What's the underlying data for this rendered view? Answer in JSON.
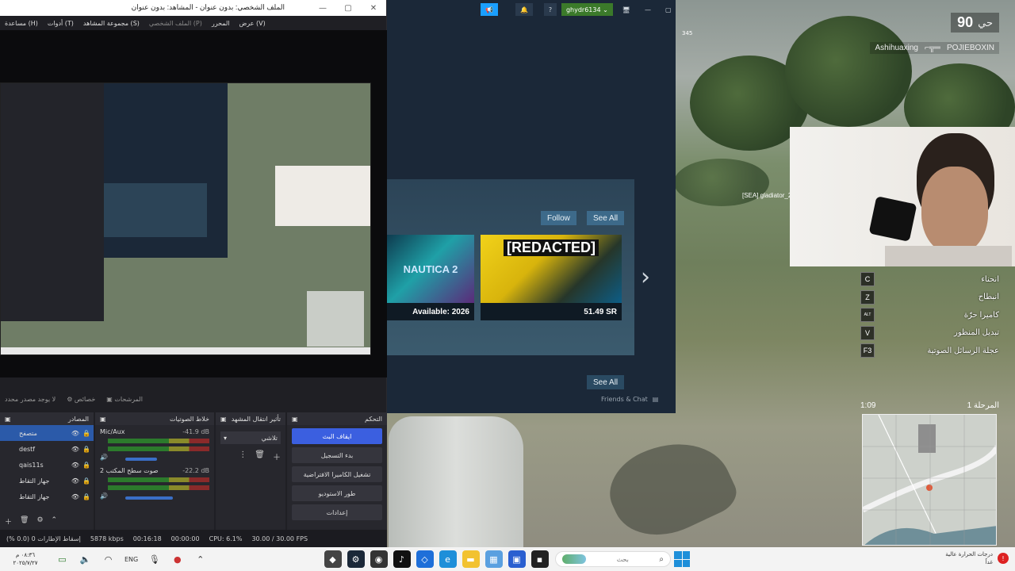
{
  "game": {
    "alive_count": "90",
    "alive_label": "حي",
    "coord": "345",
    "killfeed": {
      "left": "Ashihuaxing",
      "right": "POJIEBOXIN"
    },
    "enemy_tag": "[SEA] gladiator_22",
    "keys": [
      {
        "key": "C",
        "label": "انحناء"
      },
      {
        "key": "Z",
        "label": "انبطاح"
      },
      {
        "key": "ALT",
        "label": "كاميرا حرّة"
      },
      {
        "key": "V",
        "label": "تبديل المنظور"
      },
      {
        "key": "F3",
        "label": "عجلة الرسائل الصوتية"
      }
    ],
    "stage_label": "المرحلة 1",
    "stage_time": "1:09"
  },
  "obs": {
    "title": "الملف الشخصي: بدون عنوان - المشاهد: بدون عنوان",
    "menu": [
      "(V) عرض",
      "المحرر",
      "(P) الملف الشخصي",
      "(S) مجموعة المشاهد",
      "(T) أدوات",
      "(H) مساعدة"
    ],
    "toolbar": {
      "no_source": "لا يوجد مصدر محدد",
      "properties": "خصائص",
      "filters": "المرشحات"
    },
    "docks": {
      "sources": {
        "title": "المصادر",
        "items": [
          "متصفح",
          "destf",
          "qais11s",
          "جهاز التقاط",
          "جهاز التقاط"
        ]
      },
      "mixer": {
        "title": "خلاط الصوتيات",
        "channels": [
          {
            "name": "Mic/Aux",
            "db": "-41.9 dB",
            "level": 0.55
          },
          {
            "name": "صوت سطح المكتب 2",
            "db": "-22.2 dB",
            "level": 0.8
          }
        ]
      },
      "transitions": {
        "title": "تأثير انتقال المشهد",
        "selected": "تلاشي"
      },
      "controls": {
        "title": "التحكم",
        "buttons": [
          "ايقاف البث",
          "بدء التسجيل",
          "تشغيل الكاميرا الافتراضية",
          "طور الاستوديو",
          "إعدادات"
        ]
      }
    },
    "status": {
      "dropped": "إسقاط الإطارات 0 (0.0 %)",
      "bitrate": "5878 kbps",
      "stream_time": "00:16:18",
      "rec_time": "00:00:00",
      "cpu": "CPU: 6.1%",
      "fps": "30.00 / 30.00 FPS"
    }
  },
  "steam": {
    "username": "ghydr6134",
    "follow": "Follow",
    "see_all": "See All",
    "games": [
      {
        "title": "NAUTICA 2",
        "price": "Available: 2026"
      },
      {
        "title": "[REDACTED]",
        "price": "51.49 SR"
      }
    ],
    "friends_chat": "Friends & Chat"
  },
  "taskbar": {
    "time": "٠٨:٣٦ م",
    "date": "٢٠٢٥/٧/٢٧",
    "lang": "ENG",
    "search_placeholder": "بحث",
    "weather_title": "درجات الحرارة عالية",
    "weather_sub": "غداً"
  },
  "colors": {
    "obs_bg": "#1f1f24",
    "obs_accent": "#3b5fe0",
    "steam_bg": "#1b2838",
    "steam_button": "#3d6a8a"
  }
}
